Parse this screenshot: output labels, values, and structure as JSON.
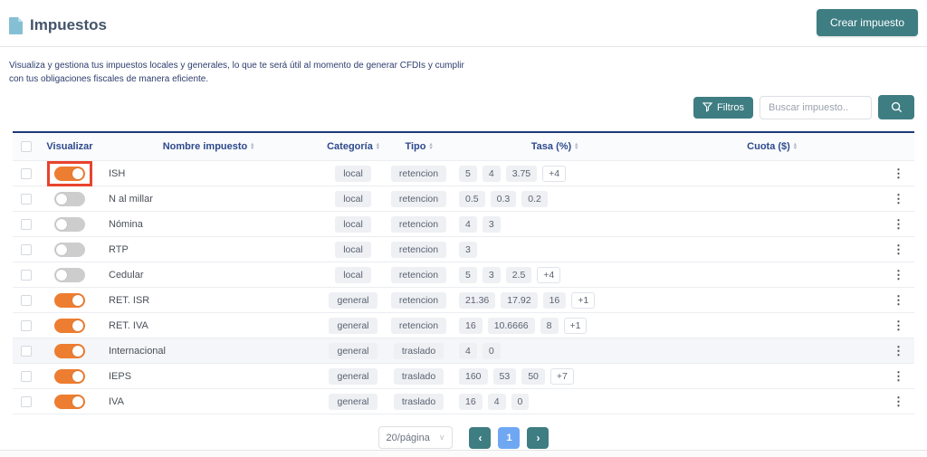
{
  "colors": {
    "teal": "#3e7d82",
    "orange_toggle": "#ed7d31",
    "annotation_red": "#e8432d",
    "active_page_blue": "#6fa7f3",
    "header_text_navy": "#2d4a8c",
    "table_top_border": "#1e3a78"
  },
  "header": {
    "title": "Impuestos",
    "create_button": "Crear impuesto"
  },
  "description": "Visualiza y gestiona tus impuestos locales y generales, lo que te será útil al momento de generar CFDIs y cumplir con tus obligaciones fiscales de manera eficiente.",
  "toolbar": {
    "filters_button": "Filtros",
    "search_placeholder": "Buscar impuesto.."
  },
  "table": {
    "columns": [
      {
        "label": "Visualizar",
        "sortable": false
      },
      {
        "label": "Nombre impuesto",
        "sortable": true
      },
      {
        "label": "Categoría",
        "sortable": true
      },
      {
        "label": "Tipo",
        "sortable": true
      },
      {
        "label": "Tasa (%)",
        "sortable": true
      },
      {
        "label": "Cuota ($)",
        "sortable": true
      }
    ],
    "rows": [
      {
        "name": "ISH",
        "enabled": true,
        "annotated": true,
        "categoria": "local",
        "tipo": "retencion",
        "tasas": [
          "5",
          "4",
          "3.75"
        ],
        "more": "+4",
        "cuotas": []
      },
      {
        "name": "N al millar",
        "enabled": false,
        "categoria": "local",
        "tipo": "retencion",
        "tasas": [
          "0.5",
          "0.3",
          "0.2"
        ],
        "cuotas": []
      },
      {
        "name": "Nómina",
        "enabled": false,
        "categoria": "local",
        "tipo": "retencion",
        "tasas": [
          "4",
          "3"
        ],
        "cuotas": []
      },
      {
        "name": "RTP",
        "enabled": false,
        "categoria": "local",
        "tipo": "retencion",
        "tasas": [
          "3"
        ],
        "cuotas": []
      },
      {
        "name": "Cedular",
        "enabled": false,
        "categoria": "local",
        "tipo": "retencion",
        "tasas": [
          "5",
          "3",
          "2.5"
        ],
        "more": "+4",
        "cuotas": []
      },
      {
        "name": "RET. ISR",
        "enabled": true,
        "categoria": "general",
        "tipo": "retencion",
        "tasas": [
          "21.36",
          "17.92",
          "16"
        ],
        "more": "+1",
        "cuotas": []
      },
      {
        "name": "RET. IVA",
        "enabled": true,
        "categoria": "general",
        "tipo": "retencion",
        "tasas": [
          "16",
          "10.6666",
          "8"
        ],
        "more": "+1",
        "cuotas": []
      },
      {
        "name": "Internacional",
        "enabled": true,
        "row_highlighted": true,
        "categoria": "general",
        "tipo": "traslado",
        "tasas": [
          "4",
          "0"
        ],
        "cuotas": []
      },
      {
        "name": "IEPS",
        "enabled": true,
        "categoria": "general",
        "tipo": "traslado",
        "tasas": [
          "160",
          "53",
          "50"
        ],
        "more": "+7",
        "cuotas": []
      },
      {
        "name": "IVA",
        "enabled": true,
        "categoria": "general",
        "tipo": "traslado",
        "tasas": [
          "16",
          "4",
          "0"
        ],
        "cuotas": []
      }
    ]
  },
  "pagination": {
    "page_size": "20/página",
    "current_page": "1"
  }
}
